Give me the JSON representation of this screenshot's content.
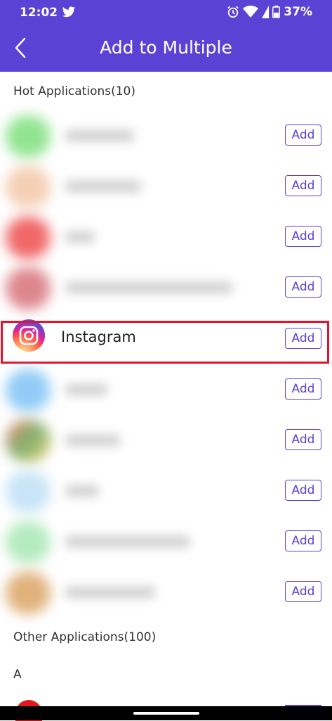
{
  "status": {
    "time": "12:02",
    "battery": "37%"
  },
  "header": {
    "title": "Add to Multiple"
  },
  "sections": {
    "hot": "Hot Applications(10)",
    "other": "Other Applications(100)",
    "letter": "A"
  },
  "hot_apps": [
    {
      "name": "",
      "add_label": "Add",
      "icon_color": "#7fe07f"
    },
    {
      "name": "",
      "add_label": "Add",
      "icon_color": "#f3c7a8"
    },
    {
      "name": "",
      "add_label": "Add",
      "icon_color": "#ef4e4e"
    },
    {
      "name": "",
      "add_label": "Add",
      "icon_color": "#d8727a"
    },
    {
      "name": "Instagram",
      "add_label": "Add",
      "icon_color": "#d6249f"
    },
    {
      "name": "",
      "add_label": "Add",
      "icon_color": "#7ec3f5"
    },
    {
      "name": "",
      "add_label": "Add",
      "icon_color": "#6aa55a"
    },
    {
      "name": "",
      "add_label": "Add",
      "icon_color": "#bfe0f5"
    },
    {
      "name": "",
      "add_label": "Add",
      "icon_color": "#a8e8b4"
    },
    {
      "name": "",
      "add_label": "Add",
      "icon_color": "#dba565"
    }
  ]
}
